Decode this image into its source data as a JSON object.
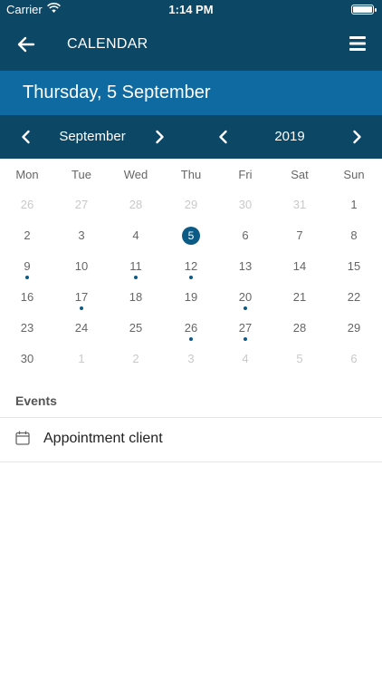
{
  "status_bar": {
    "carrier": "Carrier",
    "time": "1:14 PM"
  },
  "nav": {
    "title": "CALENDAR"
  },
  "selected_date_text": "Thursday, 5 September",
  "month_selector": {
    "month": "September",
    "year": "2019"
  },
  "weekdays": [
    "Mon",
    "Tue",
    "Wed",
    "Thu",
    "Fri",
    "Sat",
    "Sun"
  ],
  "weeks": [
    [
      {
        "d": "26",
        "o": true
      },
      {
        "d": "27",
        "o": true
      },
      {
        "d": "28",
        "o": true
      },
      {
        "d": "29",
        "o": true
      },
      {
        "d": "30",
        "o": true
      },
      {
        "d": "31",
        "o": true
      },
      {
        "d": "1"
      }
    ],
    [
      {
        "d": "2"
      },
      {
        "d": "3"
      },
      {
        "d": "4"
      },
      {
        "d": "5",
        "sel": true
      },
      {
        "d": "6"
      },
      {
        "d": "7"
      },
      {
        "d": "8"
      }
    ],
    [
      {
        "d": "9",
        "ev": true
      },
      {
        "d": "10"
      },
      {
        "d": "11",
        "ev": true
      },
      {
        "d": "12",
        "ev": true
      },
      {
        "d": "13"
      },
      {
        "d": "14"
      },
      {
        "d": "15"
      }
    ],
    [
      {
        "d": "16"
      },
      {
        "d": "17",
        "ev": true
      },
      {
        "d": "18"
      },
      {
        "d": "19"
      },
      {
        "d": "20",
        "ev": true
      },
      {
        "d": "21"
      },
      {
        "d": "22"
      }
    ],
    [
      {
        "d": "23"
      },
      {
        "d": "24"
      },
      {
        "d": "25"
      },
      {
        "d": "26",
        "ev": true
      },
      {
        "d": "27",
        "ev": true
      },
      {
        "d": "28"
      },
      {
        "d": "29"
      }
    ],
    [
      {
        "d": "30"
      },
      {
        "d": "1",
        "o": true
      },
      {
        "d": "2",
        "o": true
      },
      {
        "d": "3",
        "o": true
      },
      {
        "d": "4",
        "o": true
      },
      {
        "d": "5",
        "o": true
      },
      {
        "d": "6",
        "o": true
      }
    ]
  ],
  "events": {
    "label": "Events",
    "items": [
      {
        "title": "Appointment client",
        "icon": "calendar-icon"
      }
    ]
  },
  "colors": {
    "header": "#0c4766",
    "banner": "#0e6aa0",
    "accent": "#0c5a86"
  }
}
